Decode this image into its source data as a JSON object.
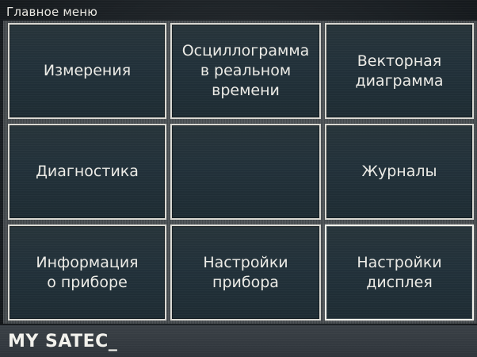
{
  "header": {
    "title": "Главное меню"
  },
  "menu": {
    "tiles": [
      {
        "label": "Измерения",
        "selected": false
      },
      {
        "label": "Осциллограмма\nв реальном\nвремени",
        "selected": false
      },
      {
        "label": "Векторная\nдиаграмма",
        "selected": false
      },
      {
        "label": "Диагностика",
        "selected": false
      },
      {
        "label": "",
        "selected": false
      },
      {
        "label": "Журналы",
        "selected": false
      },
      {
        "label": "Информация\nо приборе",
        "selected": false
      },
      {
        "label": "Настройки\nприбора",
        "selected": false
      },
      {
        "label": "Настройки\nдисплея",
        "selected": true
      }
    ]
  },
  "status": {
    "text": "MY SATEC_"
  },
  "colors": {
    "tile_background": "#22313a",
    "tile_border": "#d9d8d2",
    "text": "#ecebe6",
    "status_bar": "#343a40"
  }
}
